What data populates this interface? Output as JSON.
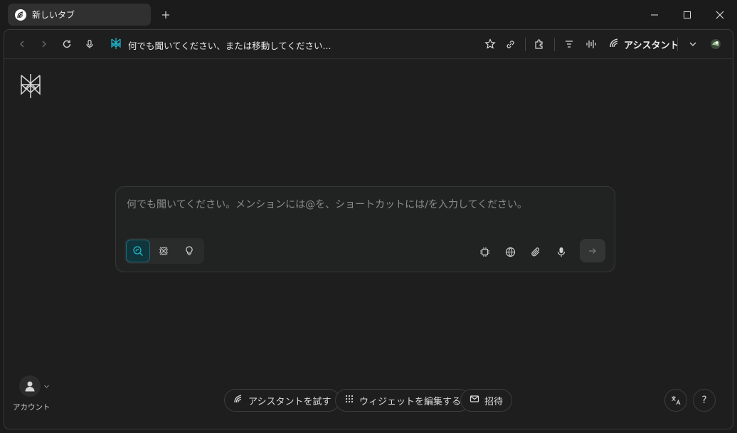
{
  "tab": {
    "title": "新しいタブ"
  },
  "address_bar": {
    "text": "何でも聞いてください、または移動してください..."
  },
  "toolbar": {
    "assistant_label": "アシスタント"
  },
  "search": {
    "placeholder": "何でも聞いてください。メンションには@を、ショートカットには/を入力してください。",
    "modes": [
      "search-mode",
      "research-mode",
      "labs-mode"
    ],
    "active_mode": "search-mode"
  },
  "account": {
    "label": "アカウント"
  },
  "bottom_actions": {
    "try_assistant": "アシスタントを試す",
    "edit_widgets": "ウィジェットを編集する",
    "invite": "招待",
    "help": "?"
  },
  "colors": {
    "accent": "#20b8cd",
    "background": "#1e1e1e"
  }
}
